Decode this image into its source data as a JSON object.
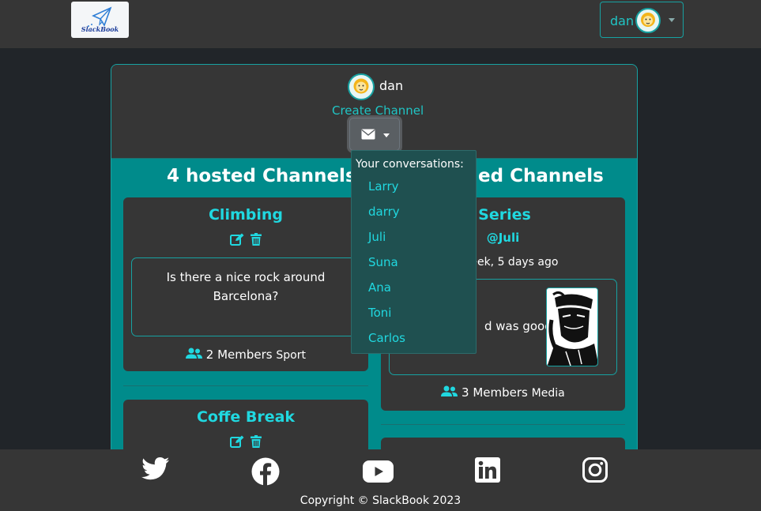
{
  "nav": {
    "logo_text": "SlackBook",
    "user_name": "dan"
  },
  "header": {
    "user_name": "dan",
    "create_channel": "Create Channel"
  },
  "hosted": {
    "title": "4 hosted Channels",
    "channels": [
      {
        "name": "Climbing",
        "post": "Is there a nice rock around Barcelona?",
        "members": "2 Members",
        "category": "Sport"
      },
      {
        "name": "Coffe Break"
      }
    ]
  },
  "joined": {
    "title_visible": "ed Channels",
    "channels": [
      {
        "name_visible": "Series",
        "author": "@Juli",
        "time_visible": "1 week, 5 days ago",
        "post_visible": "d was good!",
        "members": "3 Members",
        "category": "Media"
      }
    ]
  },
  "conversations": {
    "heading": "Your conversations:",
    "items": [
      "Larry",
      "darry",
      "Juli",
      "Suna",
      "Ana",
      "Toni",
      "Carlos"
    ]
  },
  "footer": {
    "copyright": "Copyright © SlackBook 2023",
    "social_icons": [
      "twitter-icon",
      "facebook-icon",
      "youtube-icon",
      "linkedin-icon",
      "instagram-icon"
    ]
  },
  "colors": {
    "accent": "#20d8e0",
    "teal_background": "#008b8b",
    "card": "#363636",
    "page": "#212529"
  }
}
